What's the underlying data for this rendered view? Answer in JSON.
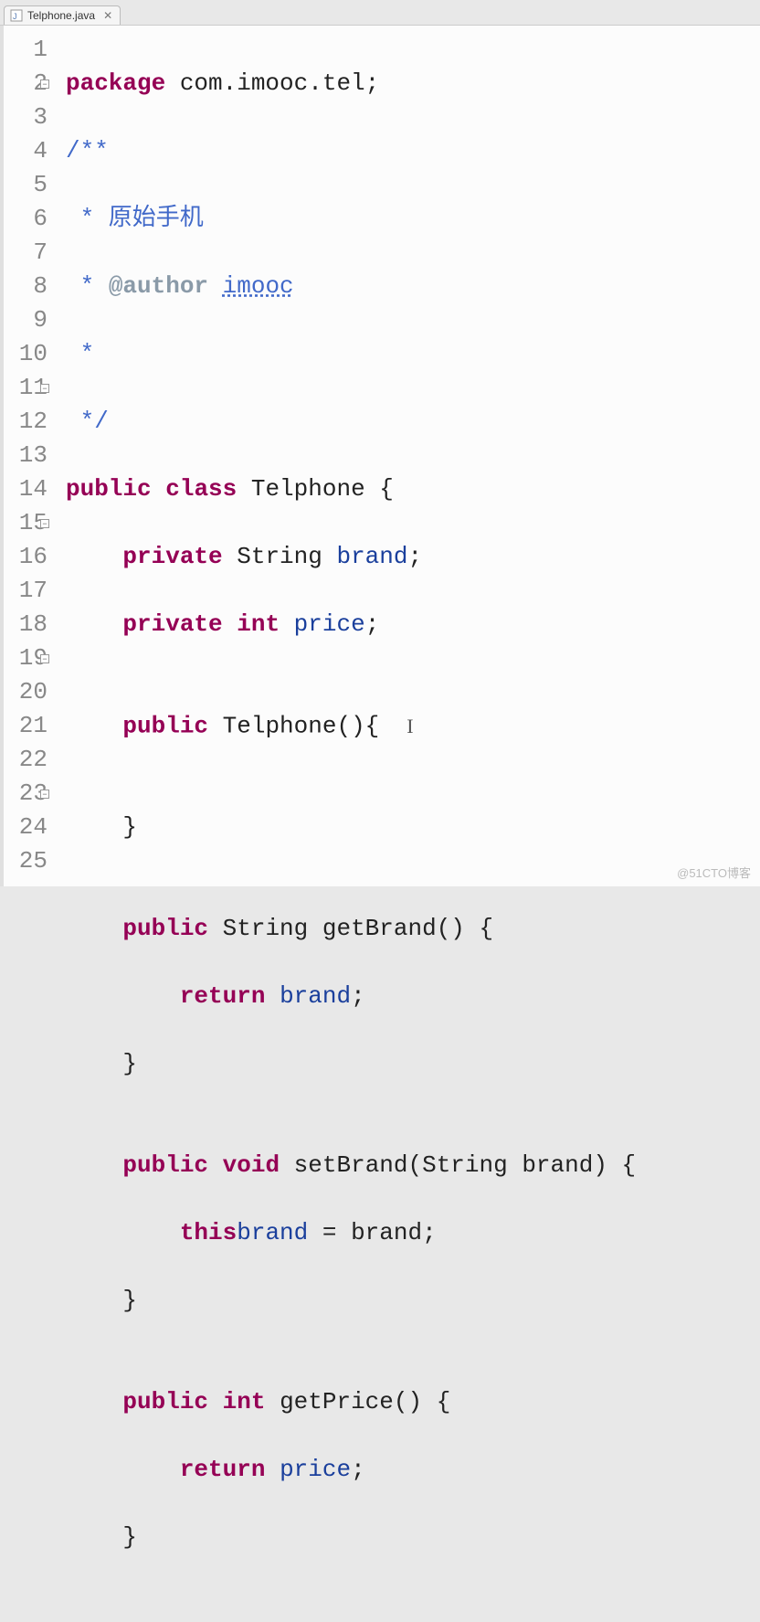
{
  "tab": {
    "filename": "Telphone.java",
    "close": "✕"
  },
  "gutter": {
    "lines": [
      "1",
      "2",
      "3",
      "4",
      "5",
      "6",
      "7",
      "8",
      "9",
      "10",
      "11",
      "12",
      "13",
      "14",
      "15",
      "16",
      "17",
      "18",
      "19",
      "20",
      "21",
      "22",
      "23",
      "24",
      "25"
    ],
    "foldable": [
      2,
      11,
      15,
      19,
      23
    ]
  },
  "code": {
    "l1": {
      "package": "package",
      "pkg": " com.imooc.tel;"
    },
    "l2": "/**",
    "l3": " * 原始手机",
    "l4": {
      "pre": " * ",
      "tag": "@author",
      "sp": " ",
      "name": "imooc"
    },
    "l5": " *",
    "l6": " */",
    "l7": {
      "public": "public",
      "class": "class",
      "name": " Telphone {"
    },
    "l8": {
      "ind": "    ",
      "private": "private",
      "type": " String ",
      "name": "brand",
      ";": ";"
    },
    "l9": {
      "ind": "    ",
      "private": "private",
      "int": "int",
      "sp": " ",
      "name": "price",
      ";": ";"
    },
    "l10": "",
    "l11": {
      "ind": "    ",
      "public": "public",
      "rest": " Telphone(){"
    },
    "l12": "",
    "l13": "    }",
    "l14": "",
    "l15": {
      "ind": "    ",
      "public": "public",
      "rest": " String getBrand() {"
    },
    "l16": {
      "ind": "        ",
      "return": "return",
      "sp": " ",
      "name": "brand",
      ";": ";"
    },
    "l17": "    }",
    "l18": "",
    "l19": {
      "ind": "    ",
      "public": "public",
      "void": "void",
      "rest": " setBrand(String brand) {"
    },
    "l20": {
      "ind": "        ",
      "this": "this",
      ".": ".",
      "field": "brand",
      "eq": " = brand;"
    },
    "l21": "    }",
    "l22": "",
    "l23": {
      "ind": "    ",
      "public": "public",
      "int": "int",
      "rest": " getPrice() {"
    },
    "l24": {
      "ind": "        ",
      "return": "return",
      "sp": " ",
      "name": "price",
      ";": ";"
    },
    "l25": "    }"
  },
  "watermark": "@51CTO博客"
}
